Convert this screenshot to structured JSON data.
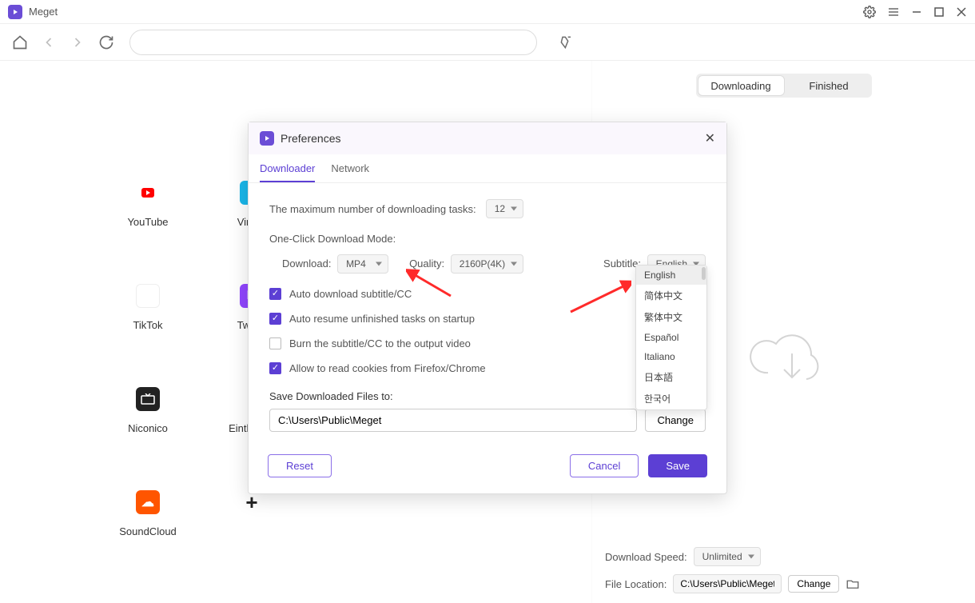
{
  "app": {
    "title": "Meget"
  },
  "sites": [
    {
      "label": "YouTube",
      "bg": "#ff0000",
      "glyph": "▶"
    },
    {
      "label": "Vimeo",
      "bg": "#1ab7ea",
      "glyph": "v"
    },
    {
      "label": "TikTok",
      "bg": "#ffffff",
      "glyph": "♪"
    },
    {
      "label": "Twitch",
      "bg": "#9146ff",
      "glyph": "tw"
    },
    {
      "label": "Niconico",
      "bg": "#222222",
      "glyph": "tv"
    },
    {
      "label": "Einthusan",
      "bg": "#ffffff",
      "glyph": "E"
    },
    {
      "label": "SoundCloud",
      "bg": "#ff5500",
      "glyph": "☁"
    },
    {
      "label": "",
      "bg": "#ffffff",
      "glyph": "+"
    }
  ],
  "rightTabs": {
    "downloading": "Downloading",
    "finished": "Finished"
  },
  "rightFooter": {
    "speedLabel": "Download Speed:",
    "speed": "Unlimited",
    "locationLabel": "File Location:",
    "location": "C:\\Users\\Public\\Meget",
    "changeBtn": "Change"
  },
  "modal": {
    "title": "Preferences",
    "tabs": {
      "downloader": "Downloader",
      "network": "Network"
    },
    "maxTasksLabel": "The maximum number of downloading tasks:",
    "maxTasks": "12",
    "modeLabel": "One-Click Download Mode:",
    "downloadLabel": "Download:",
    "downloadFormat": "MP4",
    "qualityLabel": "Quality:",
    "quality": "2160P(4K)",
    "subtitleLabel": "Subtitle:",
    "subtitleValue": "English",
    "chk_autoSub": "Auto download subtitle/CC",
    "chk_autoResume": "Auto resume unfinished tasks on startup",
    "chk_burn": "Burn the subtitle/CC to the output video",
    "chk_cookies": "Allow to read cookies from Firefox/Chrome",
    "savePathLabel": "Save Downloaded Files to:",
    "savePath": "C:\\Users\\Public\\Meget",
    "changeBtn": "Change",
    "reset": "Reset",
    "cancel": "Cancel",
    "save": "Save",
    "subtitleOptions": [
      "English",
      "简体中文",
      "繁体中文",
      "Español",
      "Italiano",
      "日本語",
      "한국어"
    ]
  }
}
